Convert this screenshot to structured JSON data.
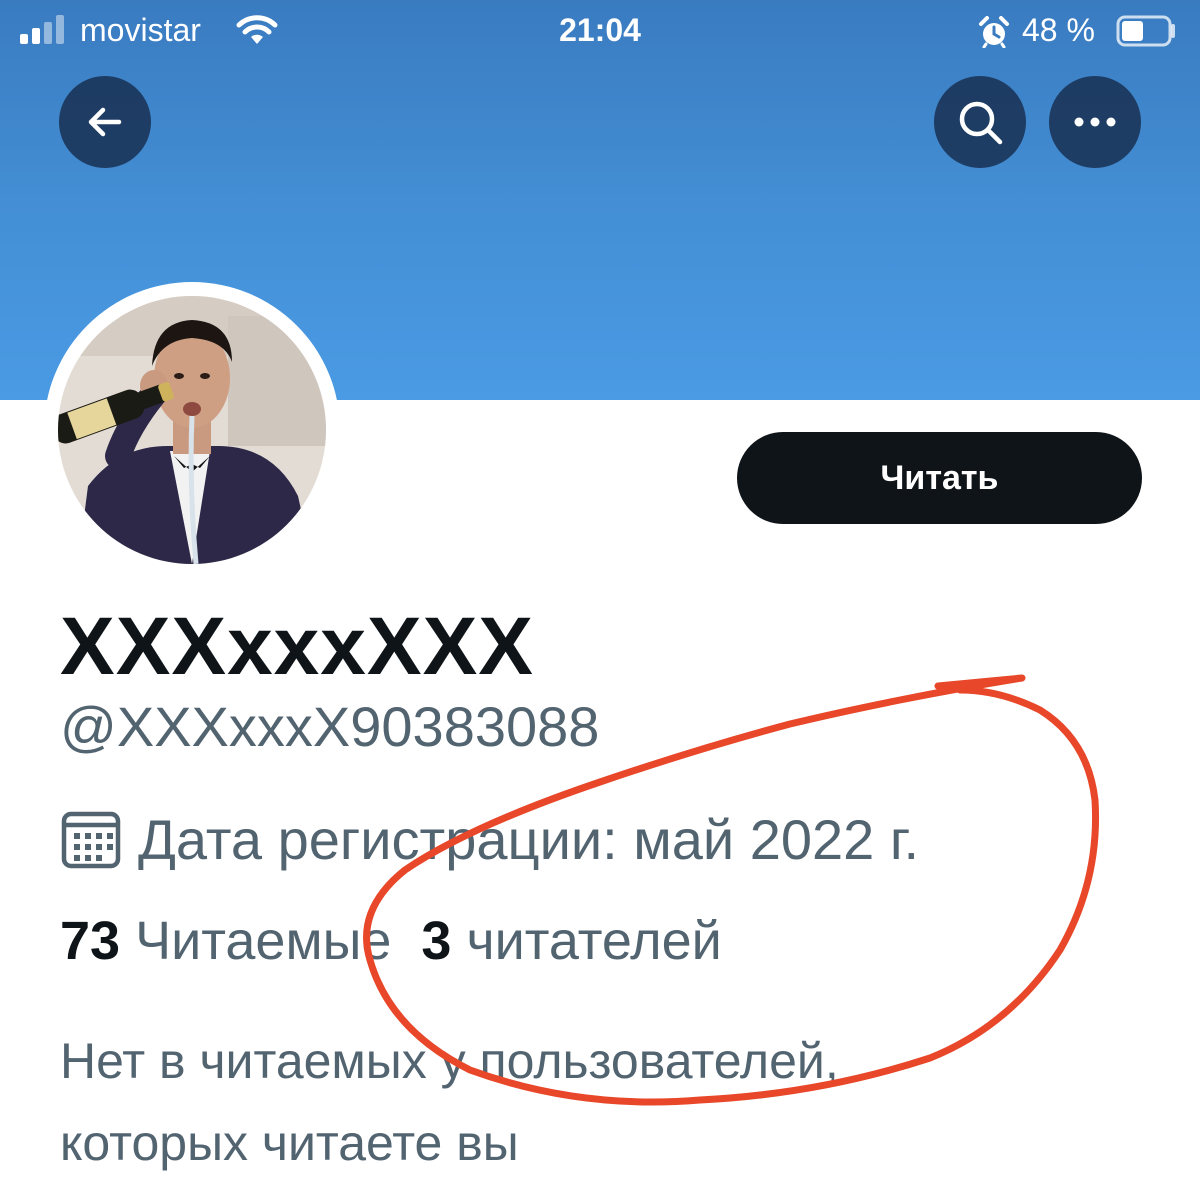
{
  "status_bar": {
    "carrier": "movistar",
    "time": "21:04",
    "battery_percent": "48 %",
    "battery_level": 0.48,
    "signal_bars_filled": 2,
    "icons": [
      "signal-icon",
      "wifi-icon",
      "alarm-icon",
      "battery-icon"
    ]
  },
  "header": {
    "banner_color": "#4a9ae4",
    "back_icon": "arrow-left-icon",
    "search_icon": "search-icon",
    "more_icon": "more-dots-icon"
  },
  "profile": {
    "follow_label": "Читать",
    "display_name": "XXXxxxXXX",
    "handle": "@XXXxxxX90383088",
    "join_date": "Дата регистрации: май 2022 г.",
    "following_count": "73",
    "following_label": "Читаемые",
    "followers_count": "3",
    "followers_label": "читателей",
    "bio_line1": "Нет в читаемых у пользователей,",
    "bio_line2": "которых читаете вы"
  },
  "colors": {
    "text_primary": "#0f1419",
    "text_secondary": "#536471",
    "annotation": "#e8472a"
  }
}
